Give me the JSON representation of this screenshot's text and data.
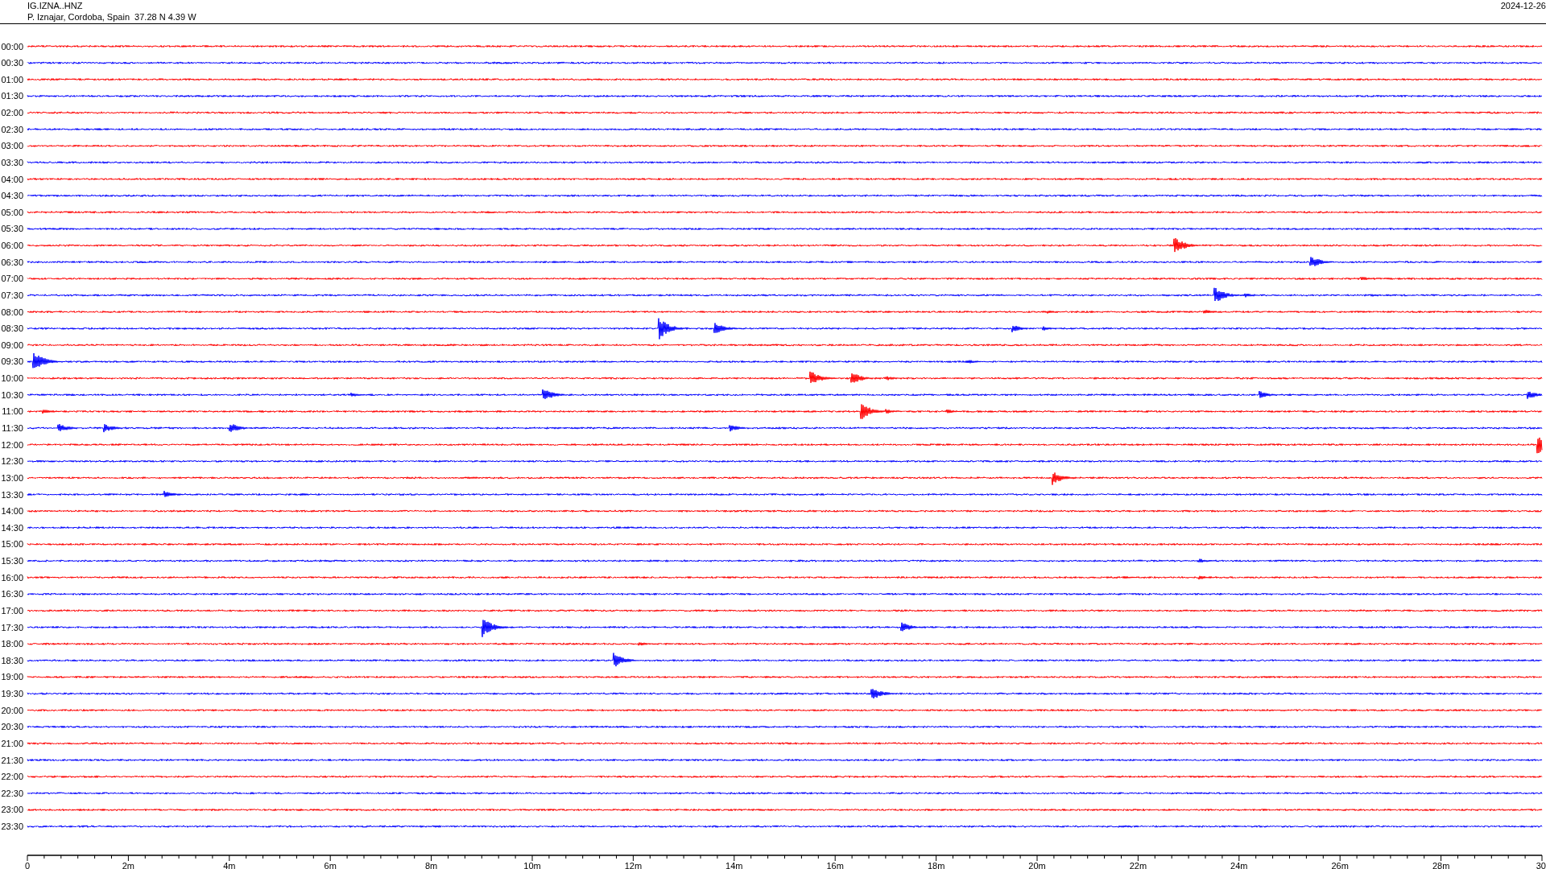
{
  "header": {
    "station": "IG.IZNA..HNZ",
    "location": "P. Iznajar, Cordoba, Spain  37.28 N 4.39 W",
    "date": "2024-12-26"
  },
  "rows": [
    {
      "label": "00:00",
      "color": "#ff0000"
    },
    {
      "label": "00:30",
      "color": "#0000ff"
    },
    {
      "label": "01:00",
      "color": "#ff0000"
    },
    {
      "label": "01:30",
      "color": "#0000ff"
    },
    {
      "label": "02:00",
      "color": "#ff0000"
    },
    {
      "label": "02:30",
      "color": "#0000ff"
    },
    {
      "label": "03:00",
      "color": "#ff0000"
    },
    {
      "label": "03:30",
      "color": "#0000ff"
    },
    {
      "label": "04:00",
      "color": "#ff0000"
    },
    {
      "label": "04:30",
      "color": "#0000ff"
    },
    {
      "label": "05:00",
      "color": "#ff0000"
    },
    {
      "label": "05:30",
      "color": "#0000ff"
    },
    {
      "label": "06:00",
      "color": "#ff0000"
    },
    {
      "label": "06:30",
      "color": "#0000ff"
    },
    {
      "label": "07:00",
      "color": "#ff0000"
    },
    {
      "label": "07:30",
      "color": "#0000ff"
    },
    {
      "label": "08:00",
      "color": "#ff0000"
    },
    {
      "label": "08:30",
      "color": "#0000ff"
    },
    {
      "label": "09:00",
      "color": "#ff0000"
    },
    {
      "label": "09:30",
      "color": "#0000ff"
    },
    {
      "label": "10:00",
      "color": "#ff0000"
    },
    {
      "label": "10:30",
      "color": "#0000ff"
    },
    {
      "label": "11:00",
      "color": "#ff0000"
    },
    {
      "label": "11:30",
      "color": "#0000ff"
    },
    {
      "label": "12:00",
      "color": "#ff0000"
    },
    {
      "label": "12:30",
      "color": "#0000ff"
    },
    {
      "label": "13:00",
      "color": "#ff0000"
    },
    {
      "label": "13:30",
      "color": "#0000ff"
    },
    {
      "label": "14:00",
      "color": "#ff0000"
    },
    {
      "label": "14:30",
      "color": "#0000ff"
    },
    {
      "label": "15:00",
      "color": "#ff0000"
    },
    {
      "label": "15:30",
      "color": "#0000ff"
    },
    {
      "label": "16:00",
      "color": "#ff0000"
    },
    {
      "label": "16:30",
      "color": "#0000ff"
    },
    {
      "label": "17:00",
      "color": "#ff0000"
    },
    {
      "label": "17:30",
      "color": "#0000ff"
    },
    {
      "label": "18:00",
      "color": "#ff0000"
    },
    {
      "label": "18:30",
      "color": "#0000ff"
    },
    {
      "label": "19:00",
      "color": "#ff0000"
    },
    {
      "label": "19:30",
      "color": "#0000ff"
    },
    {
      "label": "20:00",
      "color": "#ff0000"
    },
    {
      "label": "20:30",
      "color": "#0000ff"
    },
    {
      "label": "21:00",
      "color": "#ff0000"
    },
    {
      "label": "21:30",
      "color": "#0000ff"
    },
    {
      "label": "22:00",
      "color": "#ff0000"
    },
    {
      "label": "22:30",
      "color": "#0000ff"
    },
    {
      "label": "23:00",
      "color": "#ff0000"
    },
    {
      "label": "23:30",
      "color": "#0000ff"
    }
  ],
  "x_axis": {
    "labels": [
      "0",
      "2m",
      "4m",
      "6m",
      "8m",
      "10m",
      "12m",
      "14m",
      "16m",
      "18m",
      "20m",
      "22m",
      "24m",
      "26m",
      "28m",
      "30"
    ]
  }
}
